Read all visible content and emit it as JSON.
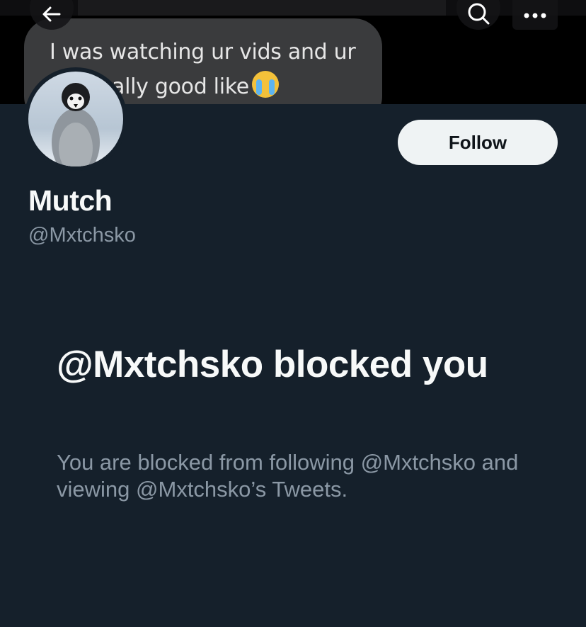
{
  "banner": {
    "message_line_1": "I was watching ur vids and ur",
    "message_line_2": "ally good like",
    "emoji_icon": "loudly-crying-face-icon"
  },
  "nav": {
    "back_icon": "arrow-left-icon",
    "search_icon": "search-icon",
    "more_icon": "more-dots-icon"
  },
  "profile": {
    "display_name": "Mutch",
    "handle": "@Mxtchsko",
    "follow_label": "Follow",
    "avatar": "penguin-chick-avatar"
  },
  "blocked": {
    "title": "@Mxtchsko blocked you",
    "message": "You are blocked from following @Mxtchsko and viewing @Mxtchsko’s Tweets."
  },
  "colors": {
    "background": "#15202b",
    "primary_text": "#f7f9f9",
    "secondary_text": "#8b98a5",
    "follow_button_bg": "#eff3f4"
  }
}
